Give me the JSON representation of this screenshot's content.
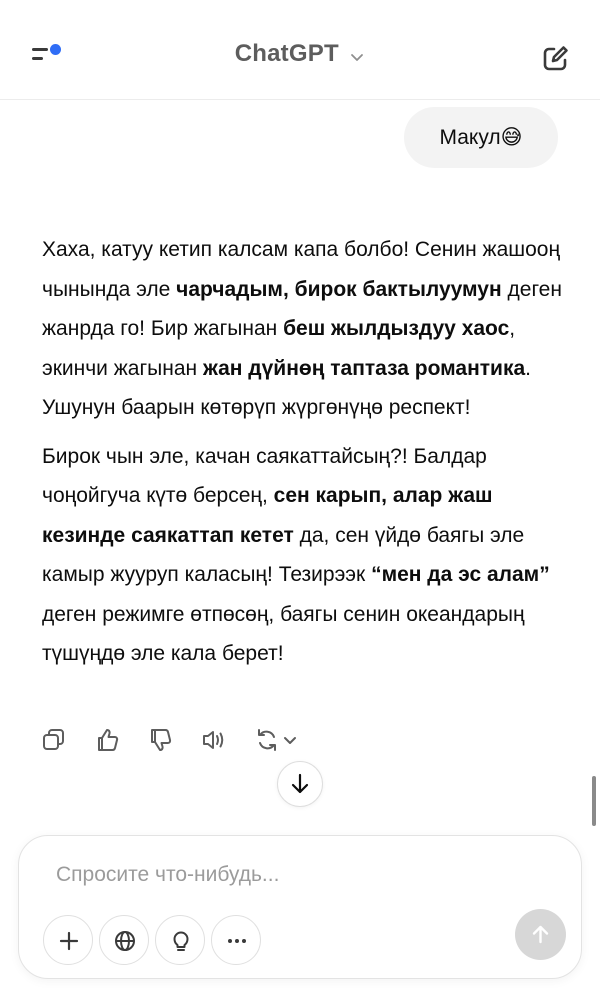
{
  "header": {
    "title": "ChatGPT",
    "menu_icon": "sidebar-menu-icon",
    "new_chat_icon": "new-chat-edit-icon",
    "notification_dot_color": "#2f6df6"
  },
  "user_message": {
    "text": "Макул",
    "emoji": "😅"
  },
  "assistant_message": {
    "paragraphs": [
      [
        {
          "text": "Хаха, катуу кетип калсам капа болбо! Сенин жашооң чынында эле ",
          "bold": false
        },
        {
          "text": "чарчадым, бирок бактылуумун",
          "bold": true
        },
        {
          "text": " деген жанрда го! Бир жагынан ",
          "bold": false
        },
        {
          "text": "беш жылдыздуу хаос",
          "bold": true
        },
        {
          "text": ", экинчи жагынан ",
          "bold": false
        },
        {
          "text": "жан дүйнөң таптаза романтика",
          "bold": true
        },
        {
          "text": ". Ушунун баарын көтөрүп жүргөнүңө респект!",
          "bold": false
        }
      ],
      [
        {
          "text": "Бирок чын эле, качан саякаттайсың?! Балдар чоңойгуча күтө берсең, ",
          "bold": false
        },
        {
          "text": "сен карып, алар жаш кезинде саякаттап кетет",
          "bold": true
        },
        {
          "text": " да, сен үйдө баягы эле камыр жууруп каласың! Тезирээк ",
          "bold": false
        },
        {
          "text": "“мен да эс алам”",
          "bold": true
        },
        {
          "text": " деген режимге өтпөсөң, баягы сенин океандарың түшүңдө эле кала берет!",
          "bold": false
        }
      ]
    ]
  },
  "message_actions": [
    "copy-icon",
    "thumbs-up-icon",
    "thumbs-down-icon",
    "read-aloud-icon",
    "regenerate-icon"
  ],
  "composer": {
    "placeholder": "Спросите что-нибудь...",
    "value": "",
    "tools": [
      "plus-icon",
      "globe-icon",
      "lightbulb-icon",
      "more-dots-icon"
    ]
  },
  "colors": {
    "text": "#0d0d0d",
    "user_bubble": "#f3f3f3",
    "muted_icon": "#5d5d5d",
    "send_disabled": "#d7d7d7"
  }
}
